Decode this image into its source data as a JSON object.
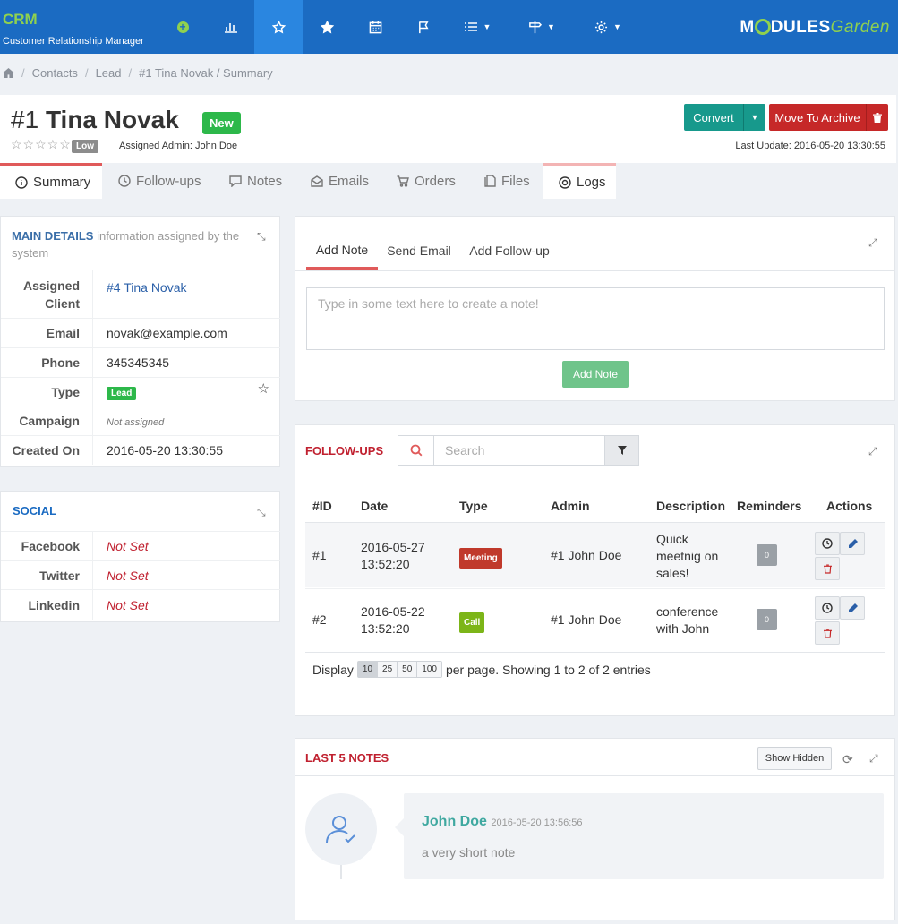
{
  "app": {
    "brand": "CRM",
    "brand_sub": "Customer Relationship Manager",
    "logo_pre": "M",
    "logo_mid": "DULES",
    "logo_post": "Garden"
  },
  "breadcrumb": {
    "items": [
      "Contacts",
      "Lead",
      "#1 Tina Novak / Summary"
    ]
  },
  "header": {
    "hash": "#1",
    "name": "Tina Novak",
    "status": "New",
    "priority": "Low",
    "assigned": "Assigned Admin: John Doe",
    "last_update": "Last Update: 2016-05-20 13:30:55",
    "convert_label": "Convert",
    "archive_label": "Move To Archive"
  },
  "tabs": [
    {
      "label": "Summary",
      "icon": "info-icon"
    },
    {
      "label": "Follow-ups",
      "icon": "clock-icon"
    },
    {
      "label": "Notes",
      "icon": "comment-icon"
    },
    {
      "label": "Emails",
      "icon": "envelope-icon"
    },
    {
      "label": "Orders",
      "icon": "cart-icon"
    },
    {
      "label": "Files",
      "icon": "files-icon"
    },
    {
      "label": "Logs",
      "icon": "globe-icon"
    }
  ],
  "main_details": {
    "title": "MAIN DETAILS",
    "subtitle": "information assigned by the system",
    "rows": [
      {
        "label": "Assigned Client",
        "value": "#4 Tina Novak"
      },
      {
        "label": "Email",
        "value": "novak@example.com"
      },
      {
        "label": "Phone",
        "value": "345345345"
      },
      {
        "label": "Type",
        "value": "Lead"
      },
      {
        "label": "Campaign",
        "value": "Not assigned"
      },
      {
        "label": "Created On",
        "value": "2016-05-20 13:30:55"
      }
    ]
  },
  "social": {
    "title": "SOCIAL",
    "rows": [
      {
        "label": "Facebook",
        "value": "Not Set"
      },
      {
        "label": "Twitter",
        "value": "Not Set"
      },
      {
        "label": "Linkedin",
        "value": "Not Set"
      }
    ]
  },
  "composer": {
    "tabs": [
      "Add Note",
      "Send Email",
      "Add Follow-up"
    ],
    "placeholder": "Type in some text here to create a note!",
    "button": "Add Note"
  },
  "followups": {
    "title": "FOLLOW-UPS",
    "search_placeholder": "Search",
    "columns": [
      "#ID",
      "Date",
      "Type",
      "Admin",
      "Description",
      "Reminders",
      "Actions"
    ],
    "rows": [
      {
        "id": "#1",
        "date1": "2016-05-27",
        "date2": "13:52:20",
        "type": "Meeting",
        "type_color": "#c0392b",
        "admin": "#1 John Doe",
        "desc": [
          "Quick",
          "meetnig on",
          "sales!"
        ],
        "reminders": "0"
      },
      {
        "id": "#2",
        "date1": "2016-05-22",
        "date2": "13:52:20",
        "type": "Call",
        "type_color": "#7cb518",
        "admin": "#1 John Doe",
        "desc": [
          "conference",
          "with John"
        ],
        "reminders": "0"
      }
    ],
    "display_label": "Display",
    "page_sizes": [
      "10",
      "25",
      "50",
      "100"
    ],
    "page_info": "per page. Showing 1 to 2 of 2 entries"
  },
  "notes": {
    "title": "LAST 5 NOTES",
    "show_hidden": "Show Hidden",
    "items": [
      {
        "author": "John Doe",
        "time": "2016-05-20 13:56:56",
        "text": "a very short note"
      }
    ]
  },
  "colors": {
    "nav": "#1b6bc2",
    "accent_red": "#e05a5a",
    "brand_green": "#8fd14f"
  }
}
